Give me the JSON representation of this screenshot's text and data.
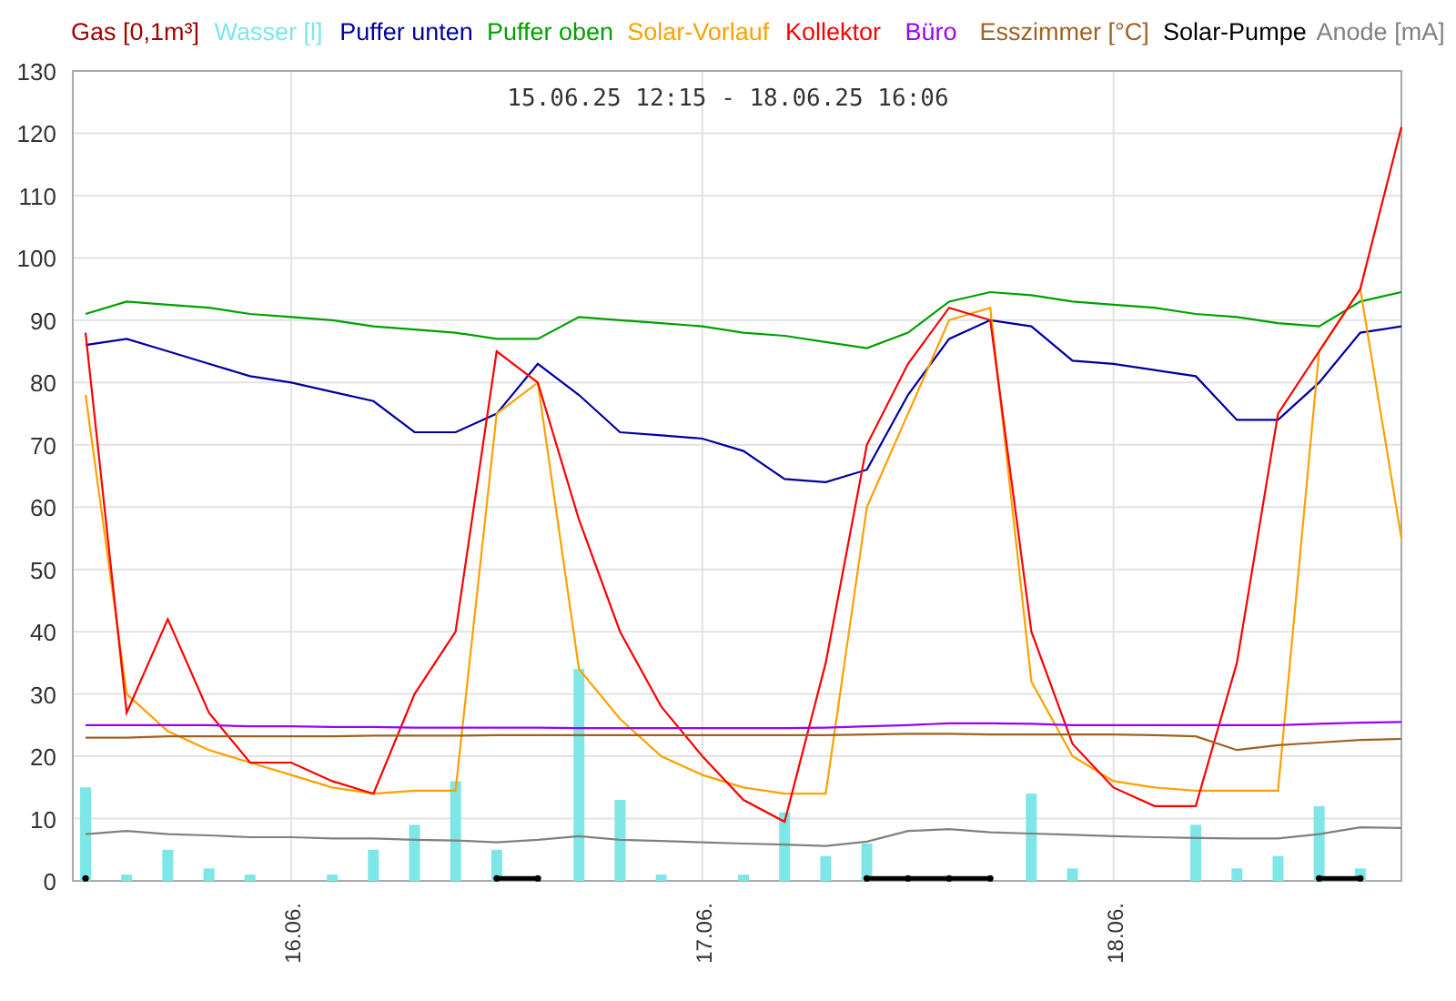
{
  "chart_data": {
    "type": "line",
    "title": "15.06.25 12:15 - 18.06.25 16:06",
    "categories": [
      null,
      null,
      null,
      null,
      null,
      "16.06.",
      null,
      null,
      null,
      null,
      null,
      null,
      null,
      null,
      null,
      "17.06.",
      null,
      null,
      null,
      null,
      null,
      null,
      null,
      null,
      null,
      "18.06.",
      null,
      null,
      null,
      null,
      null,
      null,
      null
    ],
    "ylim": [
      0,
      130
    ],
    "grid": true,
    "yticks": [
      0,
      10,
      20,
      30,
      40,
      50,
      60,
      70,
      80,
      90,
      100,
      110,
      120,
      130
    ],
    "series": [
      {
        "name": "Gas [0,1m³]",
        "color": "#a00000",
        "values": [
          null,
          null,
          null,
          null,
          null,
          null,
          null,
          null,
          null,
          null,
          null,
          null,
          null,
          null,
          null,
          null,
          null,
          null,
          null,
          null,
          null,
          null,
          null,
          null,
          null,
          null,
          null,
          null,
          null,
          null,
          null,
          null,
          null
        ]
      },
      {
        "name": "Wasser [l]",
        "color": "#7ee6e6",
        "type": "bar",
        "values": [
          15,
          1,
          5,
          2,
          1,
          0,
          1,
          5,
          9,
          16,
          5,
          null,
          34,
          13,
          1,
          0,
          1,
          11,
          4,
          6,
          null,
          0,
          null,
          14,
          2,
          0,
          0,
          9,
          2,
          4,
          12,
          2,
          0
        ]
      },
      {
        "name": "Puffer unten",
        "color": "#0000a0",
        "values": [
          86,
          87,
          85,
          83,
          81,
          80,
          78.5,
          77,
          72,
          72,
          75,
          83,
          78,
          72,
          71.5,
          71,
          69,
          64.5,
          64,
          66,
          78,
          87,
          90,
          89,
          83.5,
          83,
          82,
          81,
          74,
          74,
          80,
          88,
          89
        ]
      },
      {
        "name": "Puffer oben",
        "color": "#00a000",
        "values": [
          91,
          93,
          92.5,
          92,
          91,
          90.5,
          90,
          89,
          88.5,
          88,
          87,
          87,
          90.5,
          90,
          89.5,
          89,
          88,
          87.5,
          86.5,
          85.5,
          88,
          93,
          94.5,
          94,
          93,
          92.5,
          92,
          91,
          90.5,
          89.5,
          89,
          93,
          94.5
        ]
      },
      {
        "name": "Solar-Vorlauf",
        "color": "#ffa000",
        "values": [
          78,
          30,
          24,
          21,
          19,
          17,
          15,
          14,
          14.5,
          14.5,
          75,
          80,
          34,
          26,
          20,
          17,
          15,
          14,
          14,
          60,
          75,
          90,
          92,
          32,
          20,
          16,
          15,
          14.5,
          14.5,
          14.5,
          85,
          95,
          55
        ]
      },
      {
        "name": "Kollektor",
        "color": "#ff0000",
        "values": [
          88,
          27,
          42,
          27,
          19,
          19,
          16,
          14,
          30,
          40,
          85,
          80,
          58,
          40,
          28,
          20,
          13,
          9.5,
          35,
          70,
          83,
          92,
          90,
          40,
          22,
          15,
          12,
          12,
          35,
          75,
          85,
          95,
          121
        ]
      },
      {
        "name": "Büro",
        "color": "#9900ff",
        "values": [
          25,
          25,
          25,
          25,
          24.8,
          24.8,
          24.7,
          24.7,
          24.6,
          24.6,
          24.6,
          24.6,
          24.5,
          24.5,
          24.5,
          24.5,
          24.5,
          24.5,
          24.6,
          24.8,
          25,
          25.3,
          25.3,
          25.2,
          25,
          25,
          25,
          25,
          25,
          25,
          25.2,
          25.4,
          25.5
        ]
      },
      {
        "name": "Esszimmer [°C]",
        "color": "#a06020",
        "values": [
          23,
          23,
          23.2,
          23.2,
          23.2,
          23.2,
          23.2,
          23.3,
          23.3,
          23.3,
          23.4,
          23.4,
          23.4,
          23.4,
          23.4,
          23.4,
          23.4,
          23.4,
          23.4,
          23.5,
          23.6,
          23.6,
          23.5,
          23.5,
          23.5,
          23.5,
          23.4,
          23.2,
          21,
          21.8,
          22.2,
          22.6,
          22.8
        ]
      },
      {
        "name": "Solar-Pumpe",
        "color": "#000000",
        "type": "scatter",
        "values": [
          0.4,
          null,
          null,
          null,
          null,
          null,
          null,
          null,
          null,
          null,
          0.4,
          0.4,
          null,
          null,
          null,
          null,
          null,
          null,
          null,
          0.4,
          0.4,
          0.4,
          0.4,
          null,
          null,
          null,
          null,
          null,
          null,
          null,
          0.4,
          0.4,
          null
        ]
      },
      {
        "name": "Anode [mA]",
        "color": "#808080",
        "values": [
          7.5,
          8,
          7.5,
          7.3,
          7,
          7,
          6.8,
          6.8,
          6.6,
          6.5,
          6.2,
          6.6,
          7.2,
          6.6,
          6.4,
          6.2,
          6,
          5.8,
          5.6,
          6.3,
          8,
          8.3,
          7.8,
          7.6,
          7.4,
          7.2,
          7,
          6.9,
          6.8,
          6.8,
          7.5,
          8.6,
          8.5
        ]
      }
    ]
  }
}
